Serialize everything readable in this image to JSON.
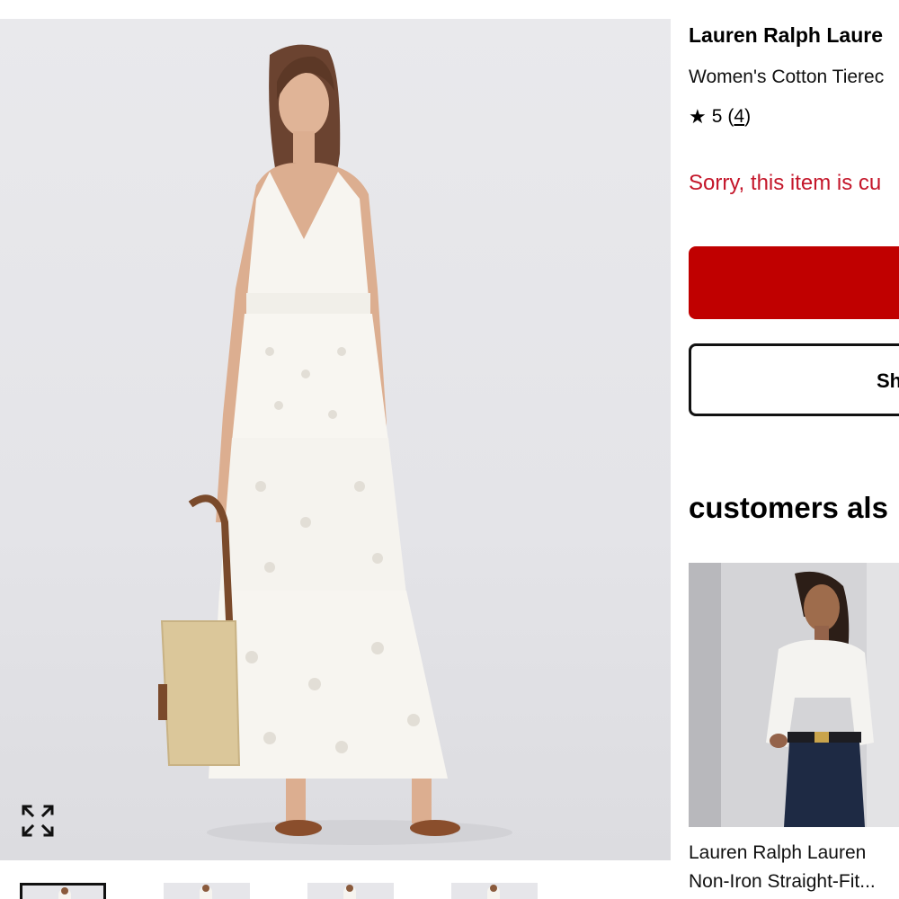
{
  "product": {
    "brand": "Lauren Ralph Laure",
    "name": "Women's Cotton Tierec",
    "rating_value": "5",
    "review_count": "4",
    "unavailable_message": "Sorry, this item is cu",
    "secondary_button_label": "Sh",
    "main_image_icon": "woman-in-white-dress-image"
  },
  "gallery": {
    "expand_icon": "expand-icon",
    "thumbnails": [
      "thumbnail-1",
      "thumbnail-2",
      "thumbnail-3",
      "thumbnail-4"
    ]
  },
  "recommendations": {
    "heading": "customers als",
    "items": [
      {
        "brand": "Lauren Ralph Lauren",
        "name": "Non-Iron Straight-Fit...",
        "image_icon": "woman-in-white-shirt-image"
      }
    ]
  },
  "colors": {
    "primary_red": "#c00000",
    "alert_red": "#c4162a",
    "text": "#000000"
  }
}
